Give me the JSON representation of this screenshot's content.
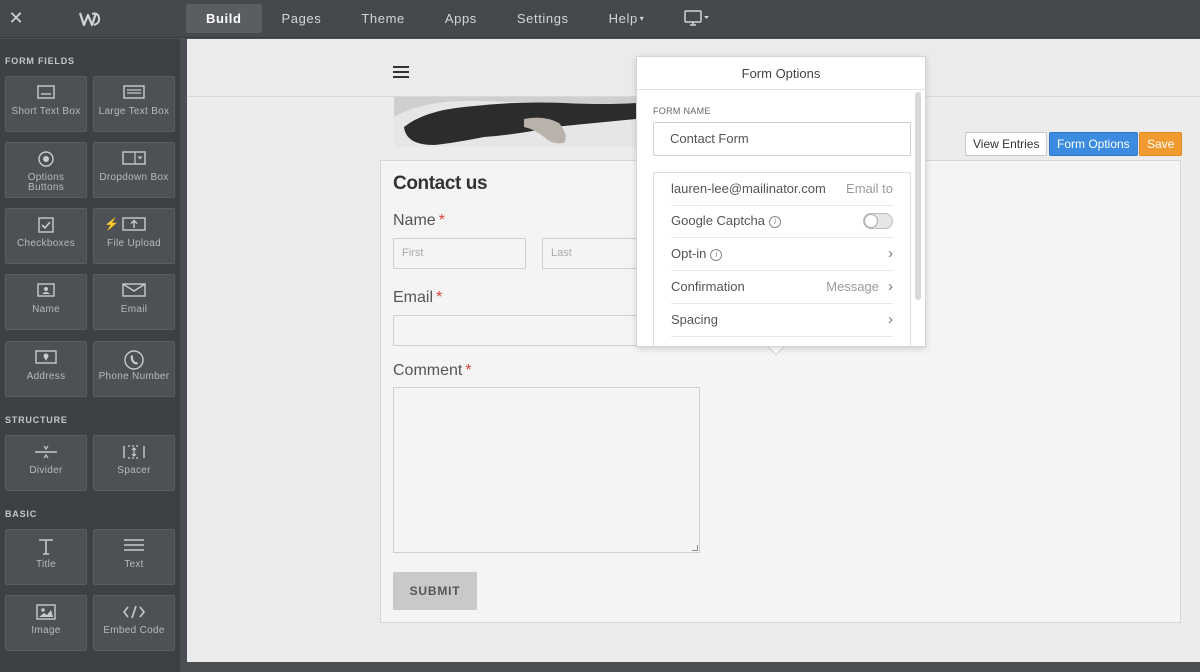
{
  "topbar": {
    "nav": [
      {
        "label": "Build",
        "active": true
      },
      {
        "label": "Pages"
      },
      {
        "label": "Theme"
      },
      {
        "label": "Apps"
      },
      {
        "label": "Settings"
      },
      {
        "label": "Help"
      }
    ],
    "help_caret": "▾"
  },
  "sidebar": {
    "form_fields_title": "FORM FIELDS",
    "structure_title": "STRUCTURE",
    "basic_title": "BASIC",
    "tiles": {
      "short_text": "Short Text Box",
      "large_text": "Large Text Box",
      "options": "Options Buttons",
      "dropdown": "Dropdown Box",
      "checkboxes": "Checkboxes",
      "file_upload": "File Upload",
      "name": "Name",
      "email": "Email",
      "address": "Address",
      "phone": "Phone Number",
      "divider": "Divider",
      "spacer": "Spacer",
      "title": "Title",
      "text": "Text",
      "image": "Image",
      "embed": "Embed Code"
    }
  },
  "toolbar": {
    "view_entries": "View Entries",
    "form_options": "Form Options",
    "save": "Save"
  },
  "form": {
    "title": "Contact us",
    "name_label": "Name",
    "first_placeholder": "First",
    "last_placeholder": "Last",
    "email_label": "Email",
    "comment_label": "Comment",
    "required_mark": "*",
    "submit": "SUBMIT"
  },
  "popup": {
    "title": "Form Options",
    "form_name_label": "FORM NAME",
    "form_name_value": "Contact Form",
    "email_value": "lauren-lee@mailinator.com",
    "email_hint": "Email to",
    "captcha_label": "Google Captcha",
    "captcha_enabled": false,
    "optin_label": "Opt-in",
    "confirmation_label": "Confirmation",
    "confirmation_value": "Message",
    "spacing_label": "Spacing"
  },
  "colors": {
    "accent_blue": "#3b8be0",
    "save_orange": "#f19a30",
    "required_red": "#d9433b"
  }
}
